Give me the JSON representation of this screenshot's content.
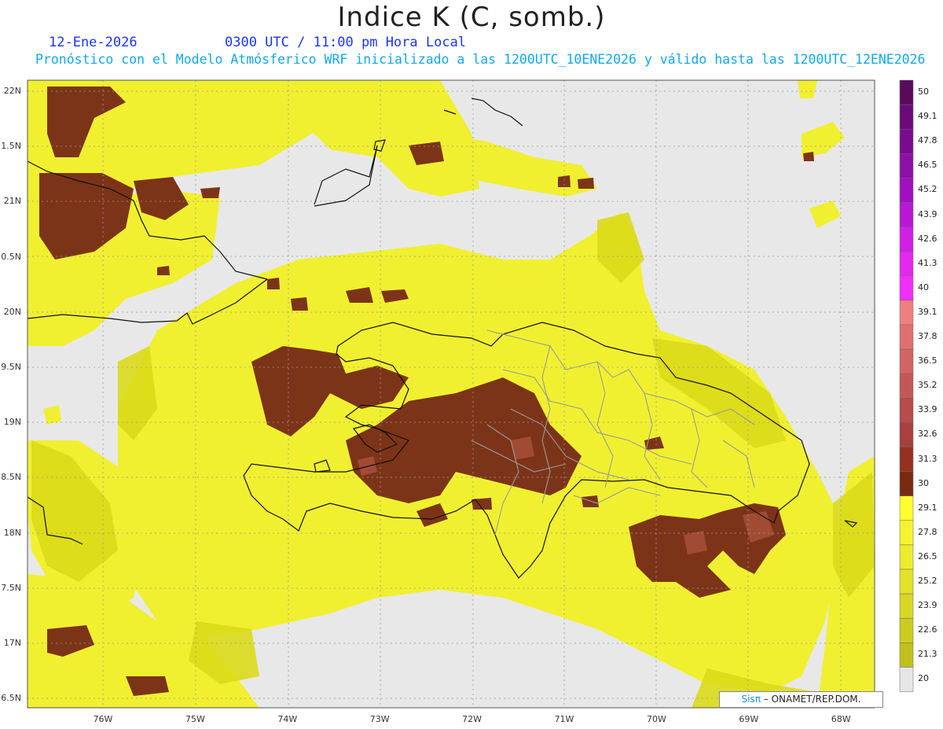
{
  "header": {
    "title": "Indice K (C, somb.)",
    "date": "12-Ene-2026",
    "time": "0300 UTC / 11:00 pm Hora Local",
    "subtitle": "Pronóstico con el Modelo Atmósferico WRF inicializado a las 1200UTC_10ENE2026 y válido hasta las  1200UTC_12ENE2026"
  },
  "axes": {
    "lat_labels": [
      "22N",
      "1.5N",
      "21N",
      "0.5N",
      "20N",
      "9.5N",
      "19N",
      "8.5N",
      "18N",
      "7.5N",
      "17N",
      "6.5N"
    ],
    "lon_labels": [
      "76W",
      "75W",
      "74W",
      "73W",
      "72W",
      "71W",
      "70W",
      "69W",
      "68W"
    ]
  },
  "colorbar": {
    "labels": [
      "50",
      "49.1",
      "47.8",
      "46.5",
      "45.2",
      "43.9",
      "42.6",
      "41.3",
      "40",
      "39.1",
      "37.8",
      "36.5",
      "35.2",
      "33.9",
      "32.6",
      "31.3",
      "30",
      "29.1",
      "27.8",
      "26.5",
      "25.2",
      "23.9",
      "22.6",
      "21.3",
      "20"
    ],
    "colors": [
      "#5a0a5a",
      "#6b0a78",
      "#7a0a8e",
      "#8c10a5",
      "#a010c0",
      "#b818d6",
      "#d020e6",
      "#e428f0",
      "#f030f8",
      "#f08080",
      "#e07070",
      "#d26464",
      "#c45858",
      "#b64c4c",
      "#a84040",
      "#963020",
      "#7a2a10",
      "#ffff30",
      "#f4f430",
      "#ecec2c",
      "#e2e228",
      "#d8d824",
      "#cccc20",
      "#c0c01c",
      "#e6e6e6"
    ]
  },
  "legend": {
    "colors": {
      "land_yellow": "#f0f030",
      "deep_yellow": "#d4d40c",
      "brown": "#7c3418",
      "pink": "#b05040",
      "sea": "#e8e8e8"
    }
  },
  "credit": {
    "brand": "Sisπ",
    "text": "– ONAMET/REP.DOM."
  }
}
